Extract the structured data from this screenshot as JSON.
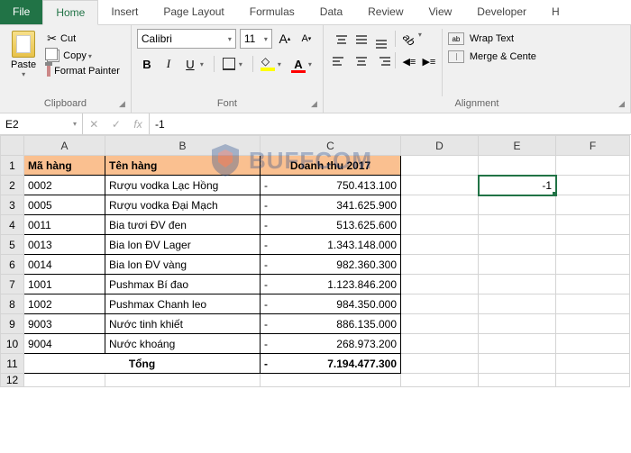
{
  "tabs": {
    "file": "File",
    "home": "Home",
    "insert": "Insert",
    "page_layout": "Page Layout",
    "formulas": "Formulas",
    "data": "Data",
    "review": "Review",
    "view": "View",
    "developer": "Developer",
    "help": "H"
  },
  "ribbon": {
    "clipboard": {
      "paste": "Paste",
      "cut": "Cut",
      "copy": "Copy",
      "format_painter": "Format Painter",
      "label": "Clipboard"
    },
    "font": {
      "font_name": "Calibri",
      "font_size": "11",
      "bold": "B",
      "italic": "I",
      "underline": "U",
      "font_color_letter": "A",
      "grow": "A",
      "shrink": "A",
      "label": "Font"
    },
    "alignment": {
      "wrap_text": "Wrap Text",
      "merge_center": "Merge & Cente",
      "orient": "ab",
      "label": "Alignment"
    }
  },
  "name_box": "E2",
  "formula_value": "-1",
  "watermark": "BUFFCOM",
  "columns": [
    "A",
    "B",
    "C",
    "D",
    "E",
    "F"
  ],
  "headers": {
    "ma_hang": "Mã hàng",
    "ten_hang": "Tên hàng",
    "doanh_thu": "Doanh thu 2017"
  },
  "rows": [
    {
      "n": "1"
    },
    {
      "n": "2",
      "ma": "0002",
      "ten": "Rượu vodka Lạc Hồng",
      "dt": "750.413.100"
    },
    {
      "n": "3",
      "ma": "0005",
      "ten": "Rượu vodka Đại Mạch",
      "dt": "341.625.900"
    },
    {
      "n": "4",
      "ma": "0011",
      "ten": "Bia tươi ĐV đen",
      "dt": "513.625.600"
    },
    {
      "n": "5",
      "ma": "0013",
      "ten": "Bia lon ĐV Lager",
      "dt": "1.343.148.000"
    },
    {
      "n": "6",
      "ma": "0014",
      "ten": "Bia lon ĐV vàng",
      "dt": "982.360.300"
    },
    {
      "n": "7",
      "ma": "1001",
      "ten": "Pushmax Bí đao",
      "dt": "1.123.846.200"
    },
    {
      "n": "8",
      "ma": "1002",
      "ten": "Pushmax Chanh leo",
      "dt": "984.350.000"
    },
    {
      "n": "9",
      "ma": "9003",
      "ten": "Nước tinh khiết",
      "dt": "886.135.000"
    },
    {
      "n": "10",
      "ma": "9004",
      "ten": "Nước khoáng",
      "dt": "268.973.200"
    }
  ],
  "total": {
    "n": "11",
    "label": "Tổng",
    "value": "7.194.477.300"
  },
  "row12": "12",
  "selected_cell_value": "-1",
  "dash": "-"
}
